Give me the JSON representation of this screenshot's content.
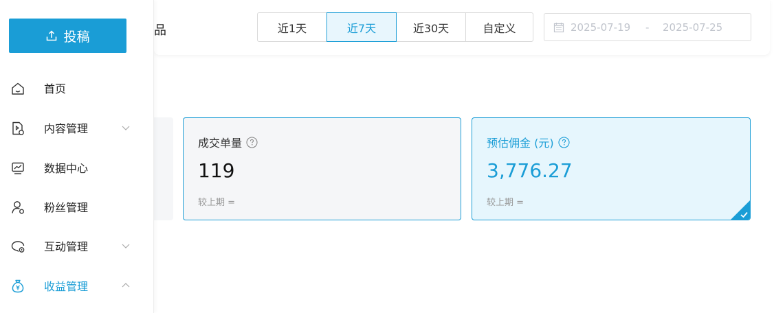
{
  "sidebar": {
    "publish_label": "投稿",
    "items": [
      {
        "label": "首页",
        "icon": "home-icon"
      },
      {
        "label": "内容管理",
        "icon": "content-icon"
      },
      {
        "label": "数据中心",
        "icon": "chart-icon"
      },
      {
        "label": "粉丝管理",
        "icon": "fans-icon"
      },
      {
        "label": "互动管理",
        "icon": "comment-icon"
      },
      {
        "label": "收益管理",
        "icon": "money-bag-icon"
      }
    ],
    "accent_color": "#1a9dd6"
  },
  "header": {
    "section_title_partial": "品",
    "periods": [
      "近1天",
      "近7天",
      "近30天",
      "自定义"
    ],
    "active_period": "近7天",
    "date_start": "2025-07-19",
    "date_separator": "-",
    "date_end": "2025-07-25"
  },
  "cards": [
    {
      "label": "成交单量",
      "value": "119",
      "comparison": "较上期 ="
    },
    {
      "label": "预估佣金 (元)",
      "value": "3,776.27",
      "comparison": "较上期 =",
      "selected": true
    }
  ]
}
